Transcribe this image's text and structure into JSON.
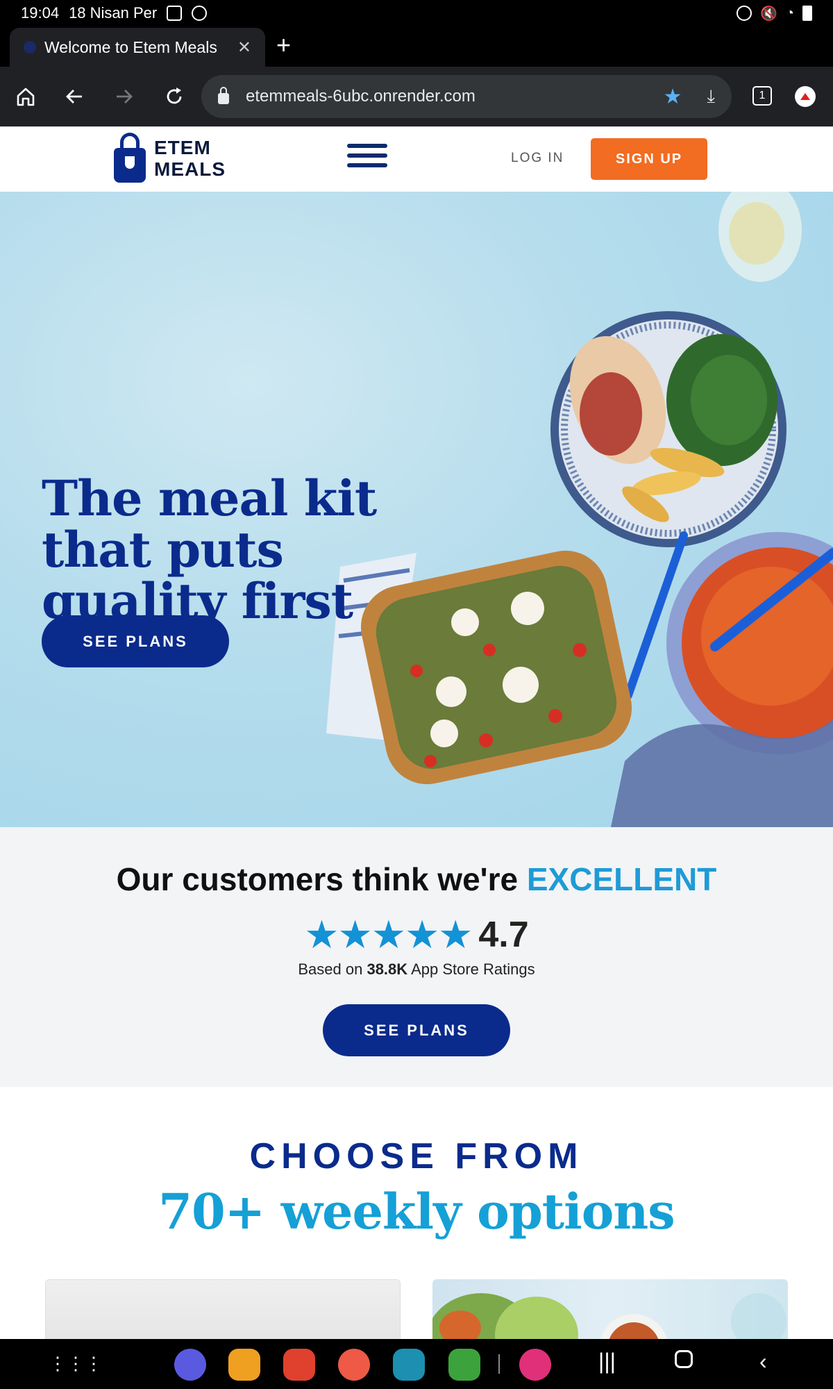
{
  "statusbar": {
    "time": "19:04",
    "date": "18 Nisan Per"
  },
  "browser": {
    "tab_title": "Welcome to Etem Meals",
    "tab_close": "✕",
    "new_tab": "+",
    "url": "etemmeals-6ubc.onrender.com",
    "tab_count": "1"
  },
  "header": {
    "logo_line1": "ETEM",
    "logo_line2": "MEALS",
    "login_label": "LOG IN",
    "signup_label": "SIGN UP"
  },
  "hero": {
    "title": "The meal kit that puts quality first",
    "cta_label": "SEE PLANS"
  },
  "ratings": {
    "heading_prefix": "Our customers think we're ",
    "heading_accent": "EXCELLENT",
    "stars": "★★★★★",
    "score": "4.7",
    "based_prefix": "Based on ",
    "based_count": "38.8K",
    "based_suffix": " App Store Ratings",
    "cta_label": "SEE PLANS"
  },
  "choose": {
    "kicker": "CHOOSE FROM",
    "headline": "70+ weekly options"
  },
  "colors": {
    "navy": "#0a2b8c",
    "orange": "#f26c21",
    "accent_blue": "#1e9bd7"
  }
}
